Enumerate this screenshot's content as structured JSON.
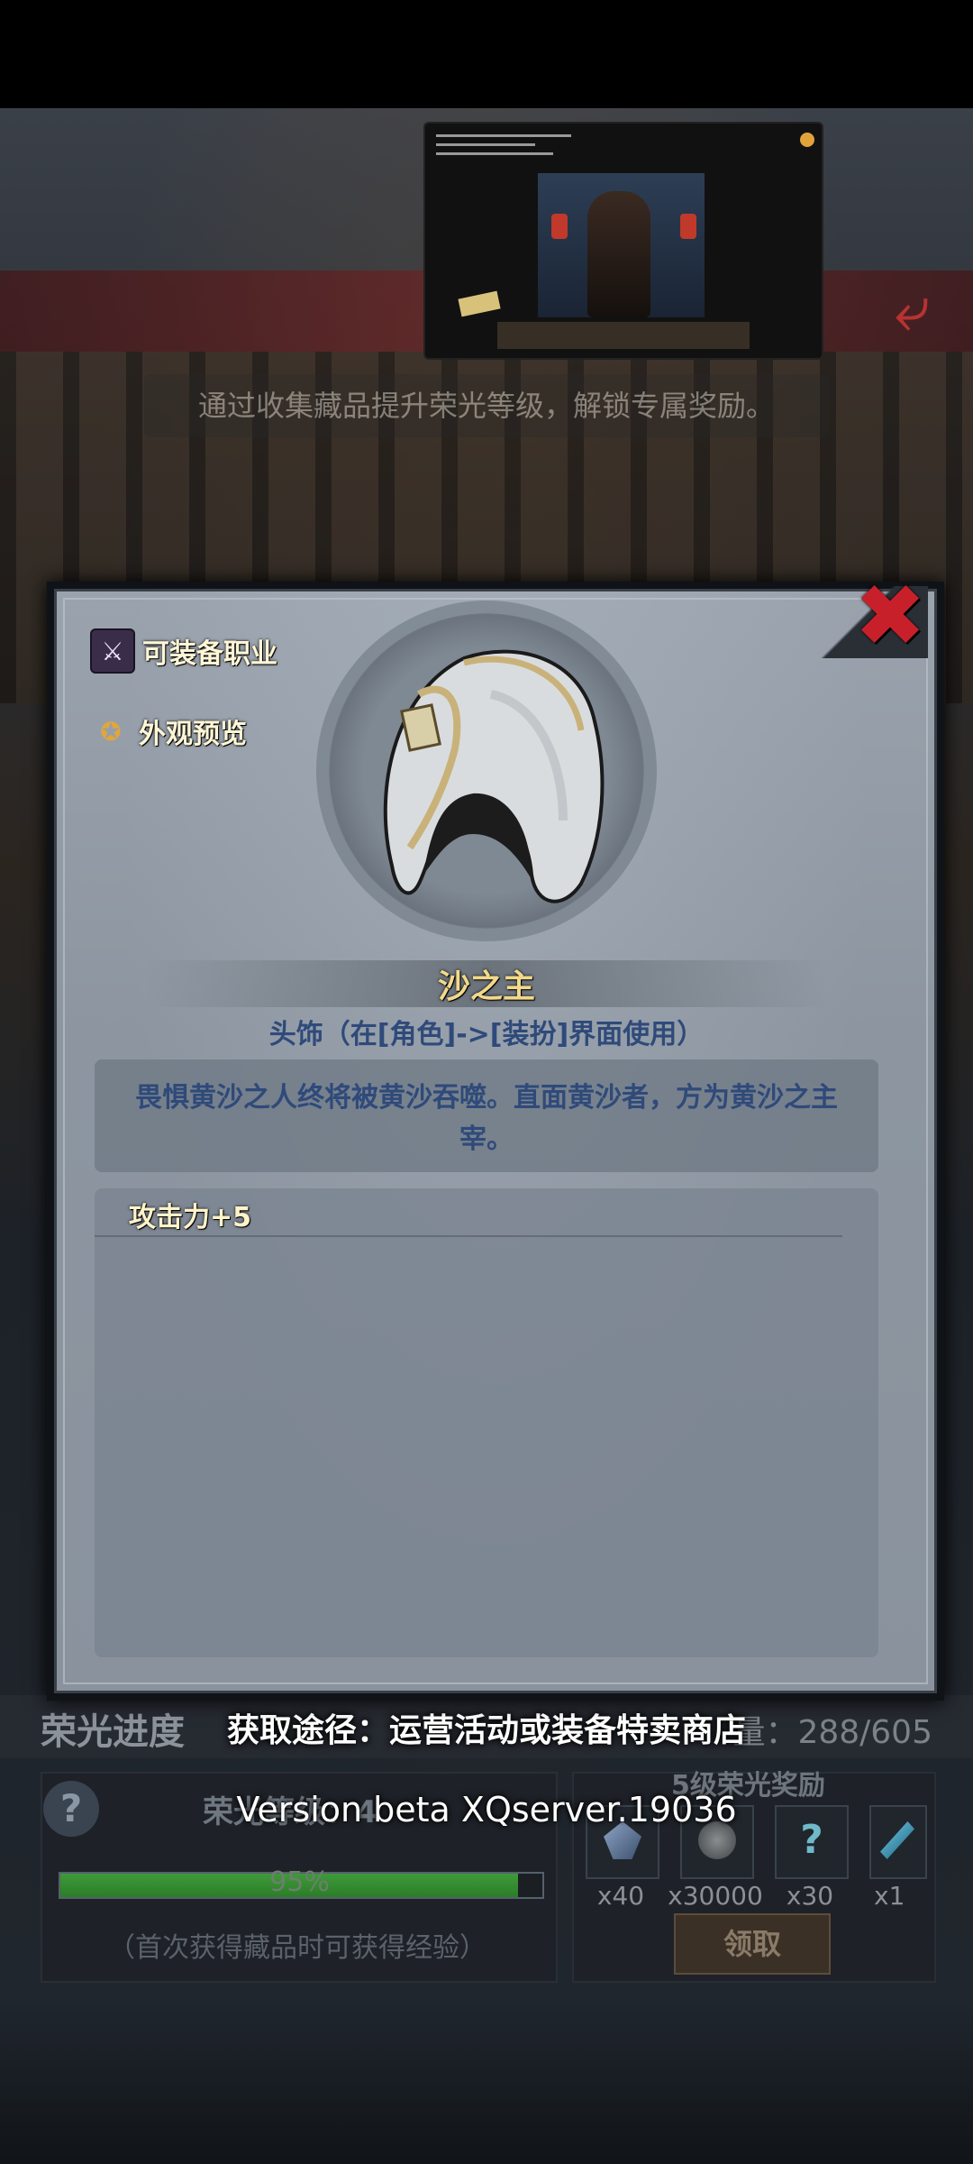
{
  "background": {
    "subtitle": "通过收集藏品提升荣光等级，解锁专属奖励。"
  },
  "dialog": {
    "side_buttons": {
      "equippable_class": "可装备职业",
      "appearance_preview": "外观预览"
    },
    "item": {
      "name": "沙之主",
      "type": "头饰（在[角色]->[装扮]界面使用）",
      "description": "畏惧黄沙之人终将被黄沙吞噬。直面黄沙者，方为黄沙之主宰。",
      "stats": [
        "攻击力+5"
      ],
      "icon": "hood-icon"
    },
    "close_icon": "close-x-icon"
  },
  "glory": {
    "progress_title": "荣光进度",
    "acquire_path": "获取途径：运营活动或装备特卖商店",
    "count_suffix": "量：288/605",
    "level_label": "荣光等级：4",
    "exp_percent": 0.95,
    "exp_text": "95%",
    "exp_note": "（首次获得藏品时可获得经验）",
    "reward_title": "5级荣光奖励",
    "rewards": [
      {
        "icon": "crystal-icon",
        "count": "x40"
      },
      {
        "icon": "coin-icon",
        "count": "x30000"
      },
      {
        "icon": "mystery-icon",
        "count": "x30"
      },
      {
        "icon": "feather-icon",
        "count": "x1"
      }
    ],
    "claim_label": "领取"
  },
  "version_text": "Version beta XQserver.19036",
  "colors": {
    "close_red": "#c8202a",
    "item_name_gold": "#f2d98a",
    "desc_blue": "#2f4a7a",
    "progress_green": "#3f9a3a"
  }
}
